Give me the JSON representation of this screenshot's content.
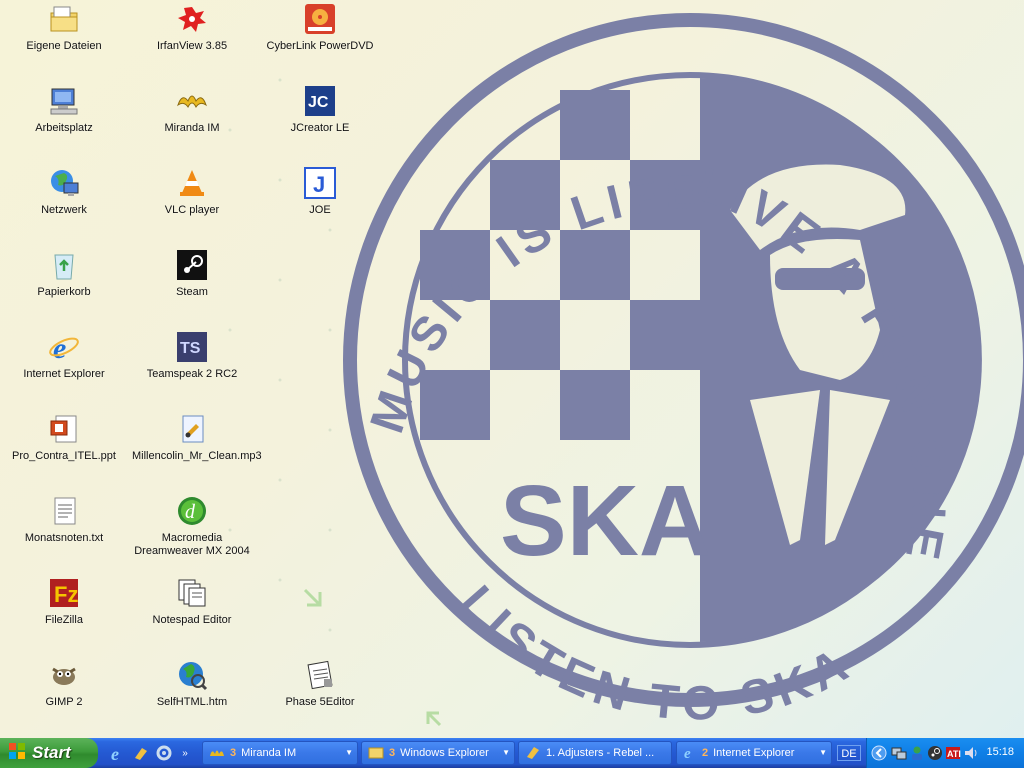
{
  "wallpaper": {
    "top_text": "MUSIC IS LIFE",
    "right_text": "LIVE A FUN ONE",
    "bottom_text": "LISTEN TO SKA",
    "center_text": "SKA"
  },
  "desktop": {
    "col1": [
      {
        "label": "Eigene Dateien",
        "icon": "my-documents-icon"
      },
      {
        "label": "Arbeitsplatz",
        "icon": "my-computer-icon"
      },
      {
        "label": "Netzwerk",
        "icon": "network-icon"
      },
      {
        "label": "Papierkorb",
        "icon": "recycle-bin-icon"
      },
      {
        "label": "Internet Explorer",
        "icon": "internet-explorer-icon"
      },
      {
        "label": "Pro_Contra_ITEL.ppt",
        "icon": "powerpoint-file-icon"
      },
      {
        "label": "Monatsnoten.txt",
        "icon": "text-file-icon"
      },
      {
        "label": "FileZilla",
        "icon": "filezilla-icon"
      },
      {
        "label": "GIMP 2",
        "icon": "gimp-icon"
      }
    ],
    "col2": [
      {
        "label": "IrfanView 3.85",
        "icon": "irfanview-icon"
      },
      {
        "label": "Miranda IM",
        "icon": "miranda-icon"
      },
      {
        "label": "VLC player",
        "icon": "vlc-icon"
      },
      {
        "label": "Steam",
        "icon": "steam-icon"
      },
      {
        "label": "Teamspeak 2 RC2",
        "icon": "teamspeak-icon"
      },
      {
        "label": "Millencolin_Mr_Clean.mp3",
        "icon": "mp3-file-icon"
      },
      {
        "label": "Macromedia Dreamweaver MX 2004",
        "icon": "dreamweaver-icon"
      },
      {
        "label": "Notespad Editor",
        "icon": "notepad-editor-icon"
      },
      {
        "label": "SelfHTML.htm",
        "icon": "html-file-icon"
      }
    ],
    "col3": [
      {
        "label": "CyberLink PowerDVD",
        "icon": "powerdvd-icon"
      },
      {
        "label": "JCreator LE",
        "icon": "jcreator-icon"
      },
      {
        "label": "JOE",
        "icon": "joe-icon"
      },
      {
        "label": "Phase 5Editor",
        "icon": "phase5-editor-icon"
      }
    ]
  },
  "taskbar": {
    "start_label": "Start",
    "tasks": [
      {
        "count": "3",
        "label": "Miranda IM",
        "grouped": true
      },
      {
        "count": "3",
        "label": "Windows Explorer",
        "grouped": true
      },
      {
        "count": "",
        "label": "1. Adjusters - Rebel ...",
        "grouped": false
      },
      {
        "count": "2",
        "label": "Internet Explorer",
        "grouped": true
      }
    ],
    "language": "DE",
    "clock": "15:18"
  },
  "colors": {
    "taskbar_blue": "#2459d2",
    "start_green": "#3c9b3a",
    "tray_blue": "#0f7fe6",
    "wallpaper_ink": "#7b80a6"
  }
}
